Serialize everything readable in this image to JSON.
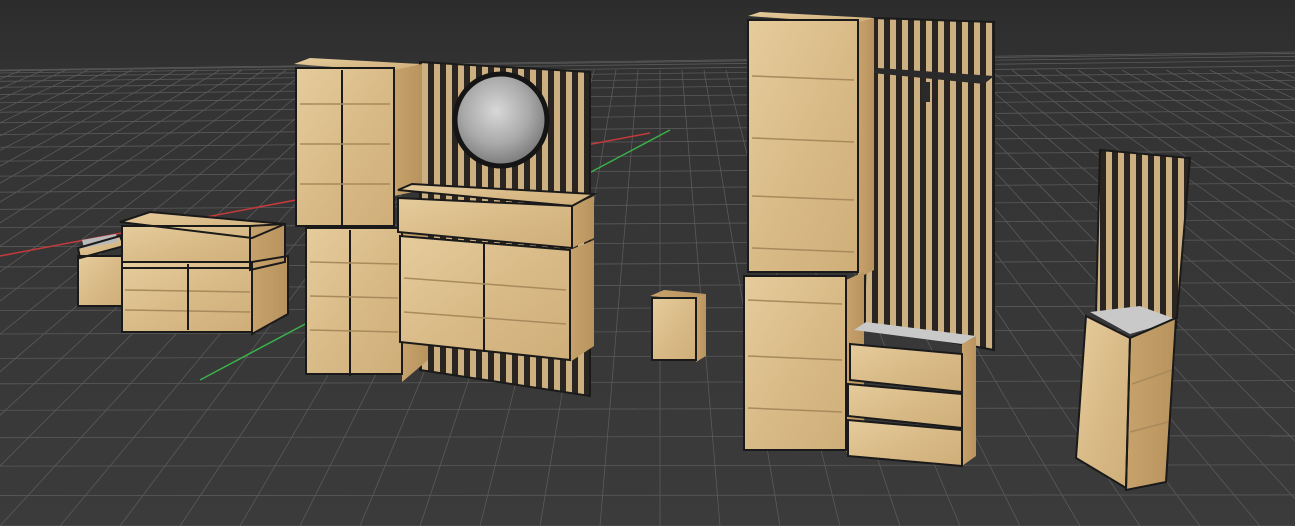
{
  "scene": {
    "background_color": "#3a3a3a",
    "grid_color": "#5a5a5a",
    "x_axis_color": "#c43a3a",
    "y_axis_color": "#3ab04a",
    "wood_color": "#dcc08e",
    "frame_color": "#1a1a1a"
  },
  "objects": [
    {
      "name": "small-drawer-unit"
    },
    {
      "name": "low-sideboard"
    },
    {
      "name": "tall-wardrobe-with-slat-wall-and-round-mirror"
    },
    {
      "name": "small-loose-panel"
    },
    {
      "name": "tall-bookcase-with-hall-bench-and-coat-rail"
    },
    {
      "name": "corner-shelf-with-slat-panel"
    }
  ]
}
